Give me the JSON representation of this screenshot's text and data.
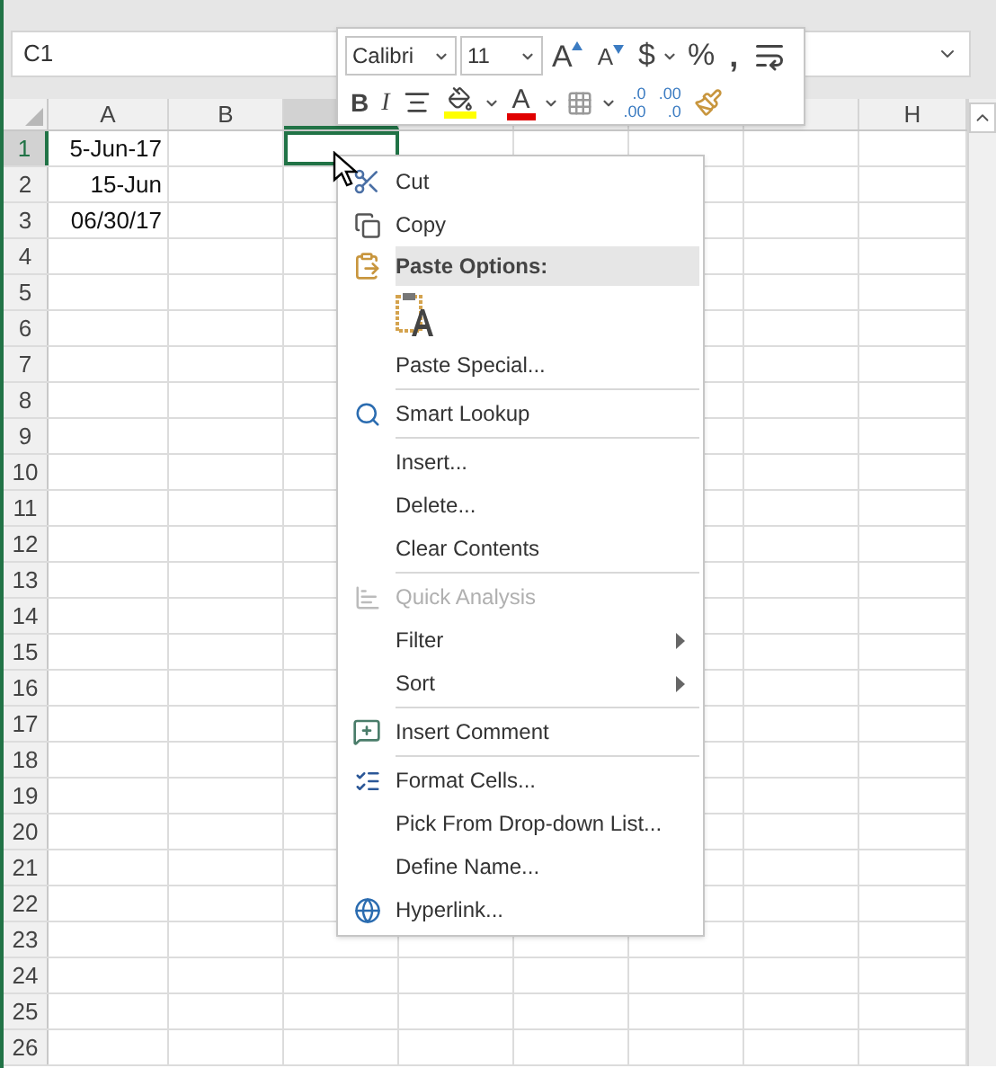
{
  "name_box": {
    "value": "C1"
  },
  "columns": [
    {
      "label": "A",
      "selected": false
    },
    {
      "label": "B",
      "selected": false
    },
    {
      "selected": true
    },
    {
      "selected": false
    },
    {
      "selected": false
    },
    {
      "selected": false
    },
    {
      "selected": false
    },
    {
      "label": "H",
      "selected": false
    }
  ],
  "rows": [
    {
      "label": "1",
      "selected": true,
      "cells": [
        {
          "text": "5-Jun-17",
          "selected": false
        },
        {
          "selected": false
        },
        {
          "selected": true
        }
      ]
    },
    {
      "label": "2",
      "selected": false,
      "cells": [
        {
          "text": "15-Jun",
          "selected": false
        }
      ]
    },
    {
      "label": "3",
      "selected": false,
      "cells": [
        {
          "text": "06/30/17",
          "selected": false
        }
      ]
    },
    {
      "label": "4",
      "selected": false
    },
    {
      "label": "5",
      "selected": false
    },
    {
      "label": "6",
      "selected": false
    },
    {
      "label": "7",
      "selected": false
    },
    {
      "label": "8",
      "selected": false
    },
    {
      "label": "9",
      "selected": false
    },
    {
      "label": "10",
      "selected": false
    },
    {
      "label": "11",
      "selected": false
    },
    {
      "label": "12",
      "selected": false
    },
    {
      "label": "13",
      "selected": false
    },
    {
      "label": "14",
      "selected": false
    },
    {
      "label": "15",
      "selected": false
    },
    {
      "label": "16",
      "selected": false
    },
    {
      "label": "17",
      "selected": false
    },
    {
      "label": "18",
      "selected": false
    },
    {
      "label": "19",
      "selected": false
    },
    {
      "label": "20",
      "selected": false
    },
    {
      "label": "21",
      "selected": false
    },
    {
      "label": "22",
      "selected": false
    },
    {
      "label": "23",
      "selected": false
    },
    {
      "label": "24",
      "selected": false
    },
    {
      "label": "25",
      "selected": false
    },
    {
      "label": "26",
      "selected": false
    }
  ],
  "mini_toolbar": {
    "font": {
      "value": "Calibri"
    },
    "size": {
      "value": "11"
    },
    "row_1": [
      {
        "kind": "grow",
        "text": "A"
      },
      {
        "kind": "shrink",
        "text": "A"
      },
      {
        "kind": "currency",
        "text": "$",
        "dropdown": true
      },
      {
        "kind": "percent",
        "text": "%"
      },
      {
        "kind": "comma",
        "text": ","
      },
      {
        "kind": "wrap"
      }
    ],
    "row_2": [
      {
        "kind": "bold",
        "text": "B"
      },
      {
        "kind": "italic",
        "text": "I"
      },
      {
        "kind": "align"
      },
      {
        "kind": "fill",
        "dropdown": true
      },
      {
        "kind": "font-color",
        "text": "A",
        "dropdown": true
      },
      {
        "kind": "borders",
        "dropdown": true
      },
      {
        "kind": "increase-decimal",
        "lines": [
          ".0",
          ".00"
        ]
      },
      {
        "kind": "decrease-decimal",
        "lines": [
          ".00",
          ".0"
        ]
      },
      {
        "kind": "format-painter"
      }
    ]
  },
  "context_menu": [
    {
      "kind": "command",
      "label": "Cut",
      "disabled": false
    },
    {
      "kind": "command",
      "label": "Copy",
      "disabled": false
    },
    {
      "kind": "header",
      "label": "Paste Options:"
    },
    {
      "kind": "paste-option"
    },
    {
      "kind": "command",
      "label": "Paste Special...",
      "disabled": false
    },
    {
      "kind": "separator"
    },
    {
      "kind": "command",
      "label": "Smart Lookup",
      "disabled": false
    },
    {
      "kind": "separator"
    },
    {
      "kind": "command",
      "label": "Insert...",
      "disabled": false
    },
    {
      "kind": "command",
      "label": "Delete...",
      "disabled": false
    },
    {
      "kind": "command",
      "label": "Clear Contents",
      "disabled": false
    },
    {
      "kind": "separator"
    },
    {
      "kind": "command",
      "label": "Quick Analysis",
      "disabled": true
    },
    {
      "kind": "submenu",
      "label": "Filter",
      "disabled": false
    },
    {
      "kind": "submenu",
      "label": "Sort",
      "disabled": false
    },
    {
      "kind": "separator"
    },
    {
      "kind": "command",
      "label": "Insert Comment",
      "disabled": false
    },
    {
      "kind": "separator"
    },
    {
      "kind": "command",
      "label": "Format Cells...",
      "disabled": false
    },
    {
      "kind": "command",
      "label": "Pick From Drop-down List...",
      "disabled": false
    },
    {
      "kind": "command",
      "label": "Define Name...",
      "disabled": false
    },
    {
      "kind": "command",
      "label": "Hyperlink...",
      "disabled": false
    }
  ]
}
